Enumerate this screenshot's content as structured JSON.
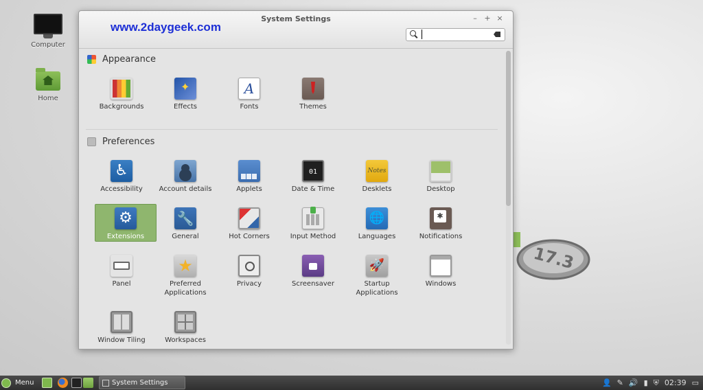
{
  "desktop": {
    "icons": [
      {
        "label": "Computer"
      },
      {
        "label": "Home"
      }
    ],
    "badge_text": "17.3"
  },
  "window": {
    "title": "System Settings",
    "watermark": "www.2daygeek.com",
    "controls": {
      "minimize": "–",
      "maximize": "+",
      "close": "×"
    },
    "search": {
      "value": "",
      "placeholder": ""
    }
  },
  "sections": {
    "appearance": {
      "title": "Appearance",
      "items": [
        {
          "label": "Backgrounds"
        },
        {
          "label": "Effects"
        },
        {
          "label": "Fonts",
          "glyph": "A"
        },
        {
          "label": "Themes"
        }
      ]
    },
    "preferences": {
      "title": "Preferences",
      "items": [
        {
          "label": "Accessibility",
          "glyph": "♿"
        },
        {
          "label": "Account details"
        },
        {
          "label": "Applets"
        },
        {
          "label": "Date & Time",
          "glyph": "01"
        },
        {
          "label": "Desklets",
          "glyph": "Notes"
        },
        {
          "label": "Desktop"
        },
        {
          "label": "Extensions",
          "glyph": "⚙",
          "selected": true
        },
        {
          "label": "General",
          "glyph": "🔧"
        },
        {
          "label": "Hot Corners"
        },
        {
          "label": "Input Method"
        },
        {
          "label": "Languages",
          "glyph": "🌐"
        },
        {
          "label": "Notifications"
        },
        {
          "label": "Panel"
        },
        {
          "label": "Preferred Applications",
          "glyph": "★"
        },
        {
          "label": "Privacy"
        },
        {
          "label": "Screensaver"
        },
        {
          "label": "Startup Applications",
          "glyph": "🚀"
        },
        {
          "label": "Windows"
        },
        {
          "label": "Window Tiling"
        },
        {
          "label": "Workspaces"
        }
      ]
    }
  },
  "taskbar": {
    "menu_label": "Menu",
    "task_label": "System Settings",
    "clock": "02:39",
    "tray_icons": [
      "user-icon",
      "pen-icon",
      "volume-icon",
      "battery-icon",
      "shield-icon",
      "clock-text",
      "display-icon"
    ]
  },
  "colors": {
    "selected": "#8fb66e",
    "watermark": "#1d2fd6",
    "mint": "#7fb94d"
  }
}
